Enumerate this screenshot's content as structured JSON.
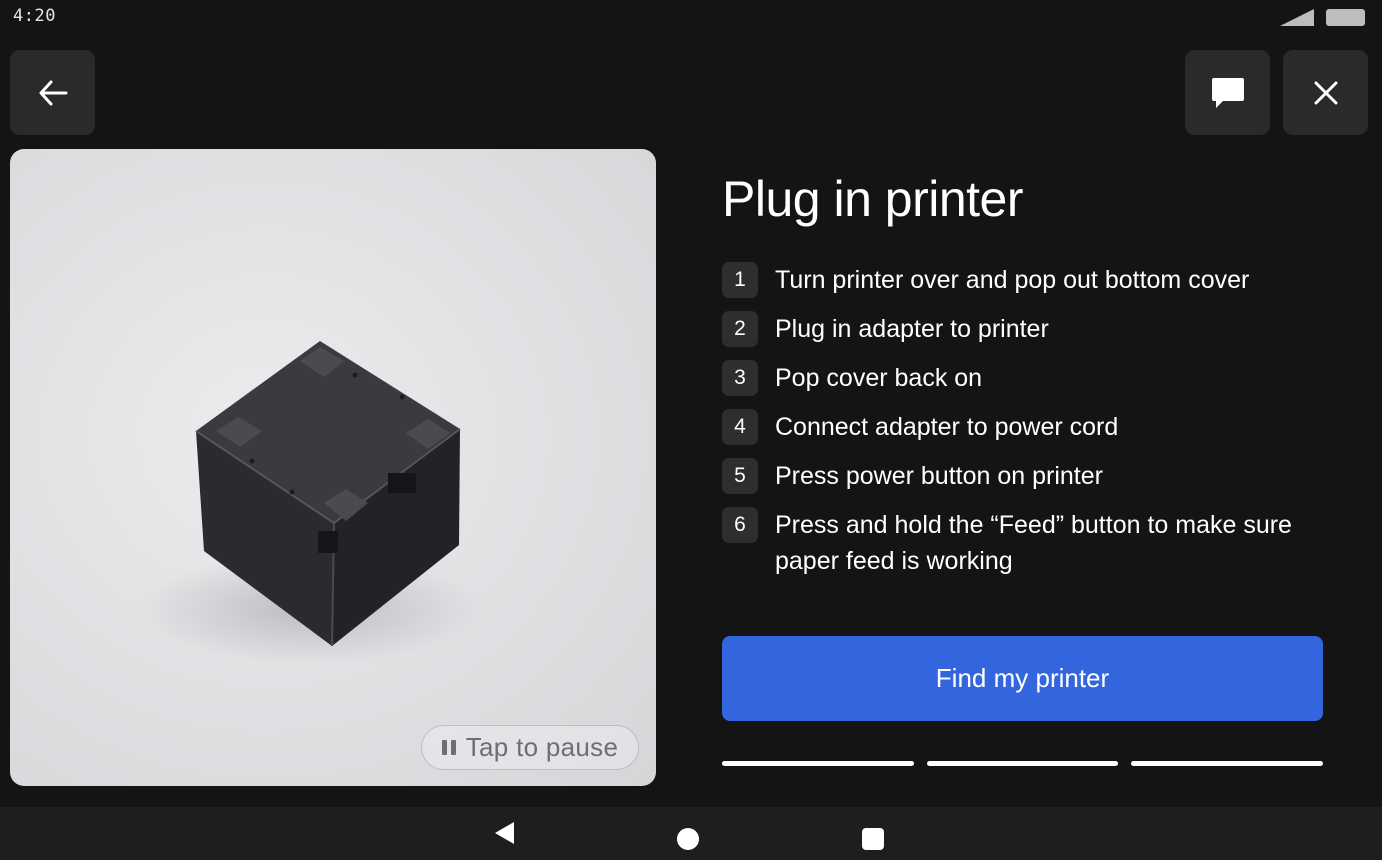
{
  "status_bar": {
    "time": "4:20"
  },
  "header": {
    "back_icon": "arrow-left-icon",
    "chat_icon": "chat-bubble-icon",
    "close_icon": "close-icon"
  },
  "media": {
    "image": "square black receipt printer, bottom view",
    "pause_label": "Tap to pause"
  },
  "content": {
    "title": "Plug in printer",
    "steps": [
      {
        "number": "1",
        "text": "Turn printer over and pop out bottom cover"
      },
      {
        "number": "2",
        "text": "Plug in adapter to printer"
      },
      {
        "number": "3",
        "text": "Pop cover back on"
      },
      {
        "number": "4",
        "text": "Connect adapter to power cord"
      },
      {
        "number": "5",
        "text": "Press power button on printer"
      },
      {
        "number": "6",
        "text": "Press and hold the “Feed” button to make sure paper feed is working"
      }
    ],
    "primary_button": "Find my printer"
  },
  "progress": {
    "steps_total": 3,
    "steps_complete": 3
  },
  "colors": {
    "background": "#141415",
    "accent": "#3265de",
    "tile": "#2a2a2c"
  }
}
